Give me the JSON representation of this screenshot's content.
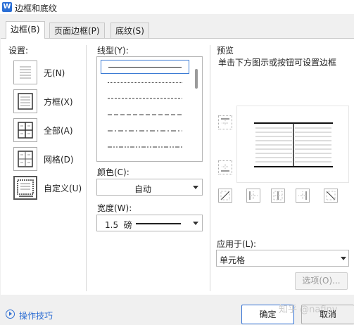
{
  "window": {
    "title": "边框和底纹",
    "app_icon_letter": "W"
  },
  "tabs": [
    {
      "label": "边框(B)",
      "active": true
    },
    {
      "label": "页面边框(P)",
      "active": false
    },
    {
      "label": "底纹(S)",
      "active": false
    }
  ],
  "settings": {
    "heading": "设置:",
    "items": [
      {
        "label": "无(N)",
        "icon": "border-none-icon"
      },
      {
        "label": "方框(X)",
        "icon": "border-box-icon"
      },
      {
        "label": "全部(A)",
        "icon": "border-all-icon"
      },
      {
        "label": "网格(D)",
        "icon": "border-grid-icon"
      },
      {
        "label": "自定义(U)",
        "icon": "border-custom-icon",
        "selected": true
      }
    ]
  },
  "line_style": {
    "heading": "线型(Y):",
    "styles": [
      "solid",
      "dotted",
      "dashed-short",
      "dashed",
      "dash-dot",
      "dash-dot-dot"
    ],
    "selected_index": 0
  },
  "color": {
    "heading": "颜色(C):",
    "value": "自动"
  },
  "width": {
    "heading": "宽度(W):",
    "value": "1.5  磅"
  },
  "preview": {
    "heading": "预览",
    "hint": "单击下方图示或按钮可设置边框"
  },
  "apply_to": {
    "heading": "应用于(L):",
    "value": "单元格"
  },
  "buttons": {
    "options": "选项(O)...",
    "ok": "确定",
    "cancel": "取消",
    "tips": "操作技巧"
  },
  "watermark": "知乎 @nafiny",
  "colors": {
    "accent": "#2f6fd3",
    "border": "#b5b5b5"
  }
}
